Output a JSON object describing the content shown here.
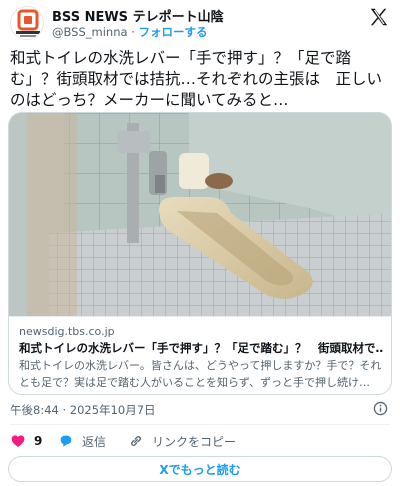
{
  "header": {
    "display_name": "BSS NEWS テレポート山陰",
    "handle": "@BSS_minna",
    "separator": "·",
    "follow_label": "フォローする",
    "avatar_icon": "teleport-logo-icon",
    "close_icon": "x-logo-icon"
  },
  "tweet": {
    "text": "和式トイレの水洗レバー「手で押す」？「足で踏む」？街頭取材では拮抗…それぞれの主張は　正しいのはどっち？メーカーに聞いてみると…"
  },
  "card": {
    "domain": "newsdig.tbs.co.jp",
    "title": "和式トイレの水洗レバー「手で押す」？「足で踏む」？　街頭取材で…",
    "description": "和式トイレの水洗レバー。皆さんは、どうやって押しますか？手で？それとも足で？実は足で踏む人がいることを知らず、ずっと手で押し続け…"
  },
  "meta": {
    "timestamp": "午後8:44 · 2025年10月7日",
    "info_icon": "info-icon"
  },
  "actions": {
    "like_count": "9",
    "reply_label": "返信",
    "copy_link_label": "リンクをコピー",
    "like_color": "#f91880"
  },
  "read_more_label": "Xでもっと読む",
  "colors": {
    "accent": "#1d9bf0",
    "text": "#0f1419",
    "secondary": "#536471",
    "border": "#cfd9de"
  }
}
